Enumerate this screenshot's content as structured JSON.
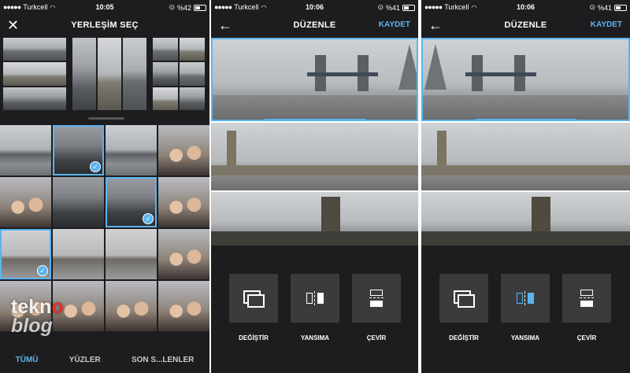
{
  "screens": [
    {
      "status": {
        "carrier": "Turkcell",
        "time": "10:05",
        "battery": "%42"
      },
      "header": {
        "title": "YERLEŞİM SEÇ"
      },
      "tabs": [
        {
          "label": "TÜMÜ",
          "active": true
        },
        {
          "label": "YÜZLER",
          "active": false
        },
        {
          "label": "SON S...LENLER",
          "active": false
        }
      ],
      "selected_photos": 4
    },
    {
      "status": {
        "carrier": "Turkcell",
        "time": "10:06",
        "battery": "%41"
      },
      "header": {
        "title": "DÜZENLE",
        "action": "KAYDET"
      },
      "tools": [
        {
          "label": "DEĞİŞTİR",
          "icon": "swap-icon"
        },
        {
          "label": "YANSIMA",
          "icon": "mirror-icon",
          "active": false
        },
        {
          "label": "ÇEVİR",
          "icon": "flip-icon"
        }
      ]
    },
    {
      "status": {
        "carrier": "Turkcell",
        "time": "10:06",
        "battery": "%41"
      },
      "header": {
        "title": "DÜZENLE",
        "action": "KAYDET"
      },
      "tools": [
        {
          "label": "DEĞİŞTİR",
          "icon": "swap-icon"
        },
        {
          "label": "YANSIMA",
          "icon": "mirror-icon",
          "active": true
        },
        {
          "label": "ÇEVİR",
          "icon": "flip-icon"
        }
      ]
    }
  ],
  "watermark": {
    "line1": "tekno",
    "line2": "blog"
  },
  "colors": {
    "accent": "#5ab4f0",
    "background": "#1d1d1f",
    "tool_bg": "#3b3b3d",
    "watermark_red": "#e0322b"
  }
}
